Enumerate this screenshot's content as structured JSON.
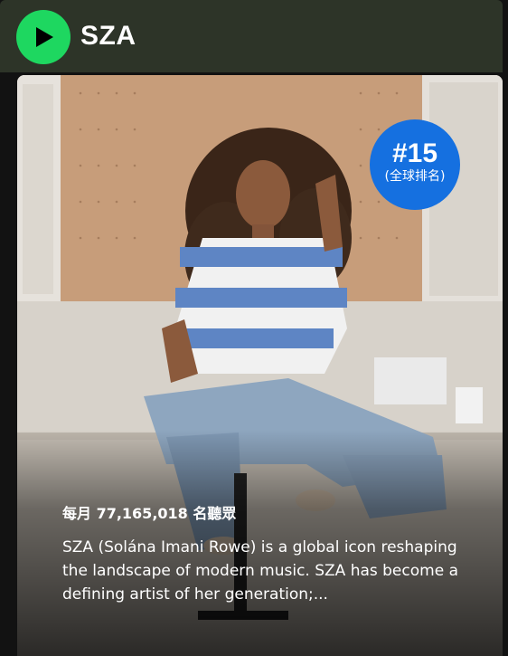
{
  "header": {
    "artist_name": "SZA",
    "play_icon": "play-icon",
    "accent_color": "#1ed760"
  },
  "card": {
    "rank": "#15",
    "rank_label": "(全球排名)",
    "rank_color": "#1570e0",
    "monthly_listeners": "每月 77,165,018 名聽眾",
    "bio": "SZA (Solána Imani Rowe) is a global icon reshaping the landscape of modern music. SZA has become a defining artist of her generation;..."
  }
}
